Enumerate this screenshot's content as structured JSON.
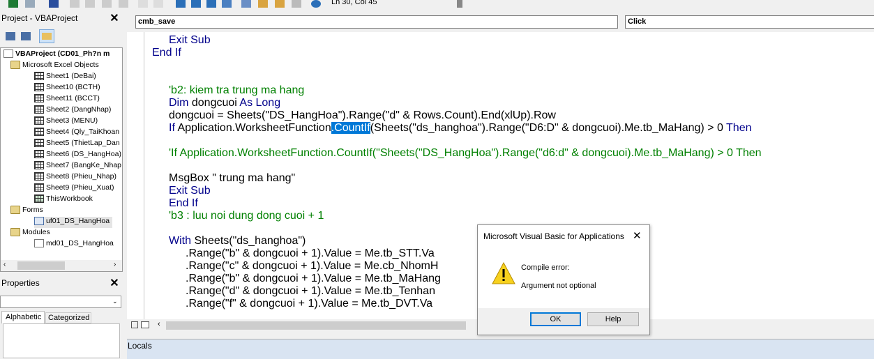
{
  "toolbar": {
    "status": "Ln 30, Col 45"
  },
  "project_panel": {
    "title": "Project - VBAProject",
    "root": "VBAProject (CD01_Ph?n m",
    "folders": {
      "excel_objects": "Microsoft Excel Objects",
      "forms": "Forms",
      "modules": "Modules"
    },
    "sheets": [
      "Sheet1 (DeBai)",
      "Sheet10 (BCTH)",
      "Sheet11 (BCCT)",
      "Sheet2 (DangNhap)",
      "Sheet3 (MENU)",
      "Sheet4 (Qly_TaiKhoan",
      "Sheet5 (ThietLap_Dan",
      "Sheet6 (DS_HangHoa)",
      "Sheet7 (BangKe_Nhap",
      "Sheet8 (Phieu_Nhap)",
      "Sheet9 (Phieu_Xuat)",
      "ThisWorkbook"
    ],
    "form_item": "uf01_DS_HangHoa",
    "module_item": "md01_DS_HangHoa"
  },
  "properties_panel": {
    "title": "Properties",
    "tab_alphabetic": "Alphabetic",
    "tab_categorized": "Categorized"
  },
  "code_window": {
    "object_combo": "cmb_save",
    "proc_combo": "Click"
  },
  "code": {
    "l1_kw": "Exit Sub",
    "l2_kw": "End If",
    "l3_cm": "'b2: kiem tra trung ma hang",
    "l4_kw": "Dim",
    "l4_text": " dongcuoi ",
    "l4_kw2": "As Long",
    "l5_text": "dongcuoi = Sheets(\"DS_HangHoa\").Range(\"d\" & Rows.Count).End(xlUp).Row",
    "l6_kw": "If",
    "l6_pre": " Application.WorksheetFunction",
    "l6_hl": ".CountIf",
    "l6_post": "(Sheets(\"ds_hanghoa\").Range(\"D6:D\" & dongcuoi).Me.tb_MaHang) > 0 ",
    "l6_kw2": "Then",
    "l7_cm": "'If Application.WorksheetFunction.CountIf(\"Sheets(\"DS_HangHoa\").Range(\"d6:d\" & dongcuoi).Me.tb_MaHang) > 0 Then",
    "l8_text": "MsgBox \" trung ma hang\"",
    "l9_kw": "Exit Sub",
    "l10_kw": "End If",
    "l11_cm": "'b3 : luu noi dung dong cuoi + 1",
    "l12_kw": "With",
    "l12_text": " Sheets(\"ds_hanghoa\")",
    "l13_text": ".Range(\"b\" & dongcuoi + 1).Value = Me.tb_STT.Va",
    "l14_text": ".Range(\"c\" & dongcuoi + 1).Value = Me.cb_NhomH",
    "l15_text": ".Range(\"b\" & dongcuoi + 1).Value = Me.tb_MaHang",
    "l16_text": ".Range(\"d\" & dongcuoi + 1).Value = Me.tb_Tenhan",
    "l17_text": ".Range(\"f\" & dongcuoi + 1).Value = Me.tb_DVT.Va"
  },
  "dialog": {
    "title": "Microsoft Visual Basic for Applications",
    "line1": "Compile error:",
    "line2": "Argument not optional",
    "ok": "OK",
    "help": "Help"
  },
  "bottom": {
    "locals": "Locals"
  },
  "colors": {
    "keyword": "#00008b",
    "comment": "#008000",
    "selection": "#0078d7",
    "locals_bar": "#d9e4f2"
  }
}
